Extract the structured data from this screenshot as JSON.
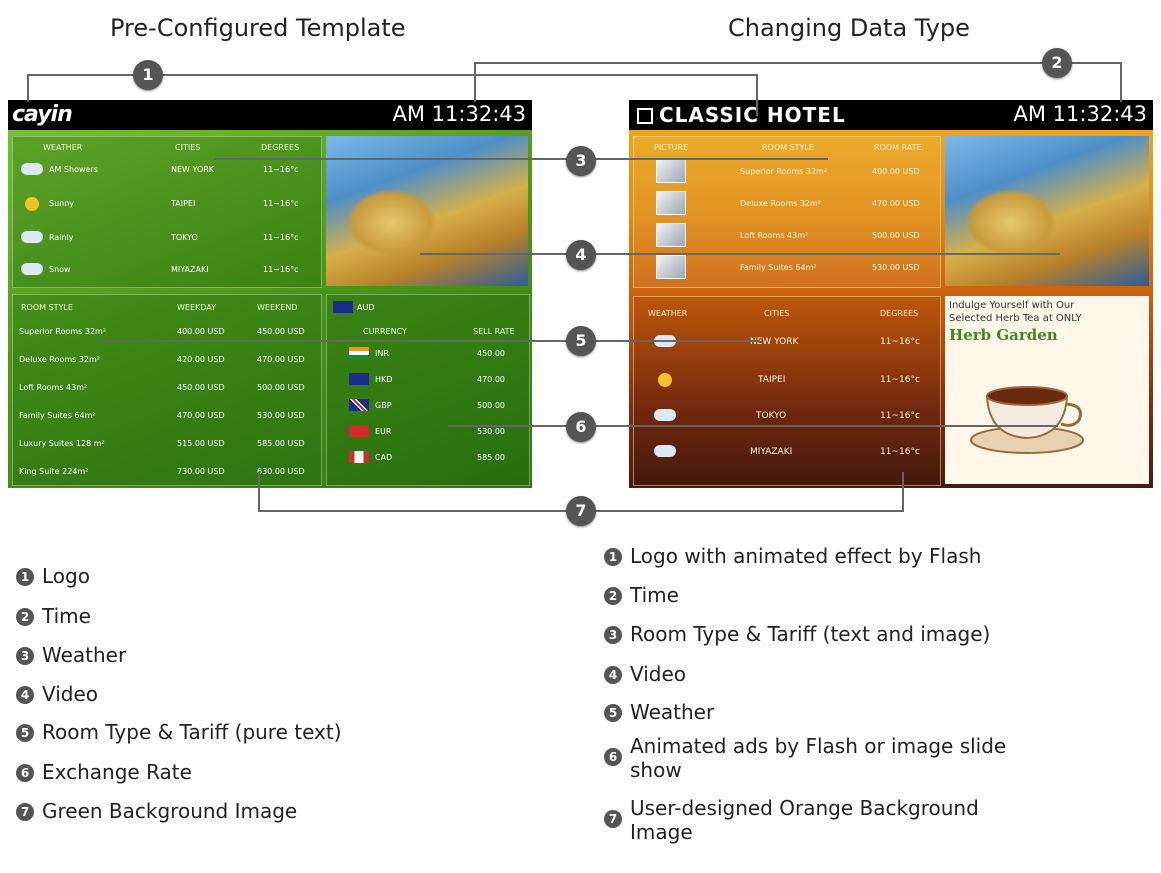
{
  "headings": {
    "left": "Pre-Configured Template",
    "right": "Changing Data Type"
  },
  "left_panel": {
    "time": "AM 11:32:43",
    "logo_text": "cayin",
    "weather": {
      "headers": [
        "WEATHER",
        "CITIES",
        "DEGREES"
      ],
      "rows": [
        {
          "weather": "AM Showers",
          "city": "NEW YORK",
          "degrees": "11~16°c"
        },
        {
          "weather": "Sunny",
          "city": "TAIPEI",
          "degrees": "11~16°c"
        },
        {
          "weather": "Rainly",
          "city": "TOKYO",
          "degrees": "11~16°c"
        },
        {
          "weather": "Snow",
          "city": "MIYAZAKI",
          "degrees": "11~16°c"
        }
      ]
    },
    "rooms": {
      "headers": [
        "ROOM STYLE",
        "WEEKDAY",
        "WEEKEND"
      ],
      "rows": [
        {
          "style": "Superior Rooms 32m²",
          "weekday": "400.00 USD",
          "weekend": "450.00 USD"
        },
        {
          "style": "Deluxe Rooms 32m²",
          "weekday": "420.00 USD",
          "weekend": "470.00 USD"
        },
        {
          "style": "Loft Rooms 43m²",
          "weekday": "450.00 USD",
          "weekend": "500.00 USD"
        },
        {
          "style": "Family Suites 64m²",
          "weekday": "470.00 USD",
          "weekend": "530.00 USD"
        },
        {
          "style": "Luxury Suites 128 m²",
          "weekday": "515.00 USD",
          "weekend": "585.00 USD"
        },
        {
          "style": "King Suite 224m²",
          "weekday": "730.00 USD",
          "weekend": "630.00 USD"
        }
      ]
    },
    "exchange": {
      "base": "AUD",
      "headers": [
        "CURRENCY",
        "SELL RATE"
      ],
      "rows": [
        {
          "currency": "INR",
          "rate": "450.00"
        },
        {
          "currency": "HKD",
          "rate": "470.00"
        },
        {
          "currency": "GBP",
          "rate": "500.00"
        },
        {
          "currency": "EUR",
          "rate": "530.00"
        },
        {
          "currency": "CAD",
          "rate": "585.00"
        }
      ]
    }
  },
  "right_panel": {
    "time": "AM 11:32:43",
    "logo_text": "CLASSIC HOTEL",
    "rooms": {
      "headers": [
        "PICTURE",
        "ROOM STYLE",
        "ROOM RATE"
      ],
      "rows": [
        {
          "style": "Superior Rooms 32m²",
          "rate": "400.00 USD"
        },
        {
          "style": "Deluxe Rooms 32m²",
          "rate": "470.00 USD"
        },
        {
          "style": "Loft Rooms 43m²",
          "rate": "500.00 USD"
        },
        {
          "style": "Family Suites 64m²",
          "rate": "530.00 USD"
        }
      ]
    },
    "weather": {
      "headers": [
        "WEATHER",
        "CITIES",
        "DEGREES"
      ],
      "rows": [
        {
          "city": "NEW YORK",
          "degrees": "11~16°c"
        },
        {
          "city": "TAIPEI",
          "degrees": "11~16°c"
        },
        {
          "city": "TOKYO",
          "degrees": "11~16°c"
        },
        {
          "city": "MIYAZAKI",
          "degrees": "11~16°c"
        }
      ]
    },
    "ad": {
      "line1": "Indulge Yourself with Our",
      "line2": "Selected Herb Tea at ONLY",
      "title": "Herb Garden"
    }
  },
  "callouts": [
    "1",
    "2",
    "3",
    "4",
    "5",
    "6",
    "7"
  ],
  "legend_left": [
    {
      "num": "1",
      "text": "Logo"
    },
    {
      "num": "2",
      "text": "Time"
    },
    {
      "num": "3",
      "text": "Weather"
    },
    {
      "num": "4",
      "text": "Video"
    },
    {
      "num": "5",
      "text": "Room Type & Tariff (pure text)"
    },
    {
      "num": "6",
      "text": "Exchange Rate"
    },
    {
      "num": "7",
      "text": "Green Background Image"
    }
  ],
  "legend_right": [
    {
      "num": "1",
      "text": "Logo with animated effect by Flash"
    },
    {
      "num": "2",
      "text": "Time"
    },
    {
      "num": "3",
      "text": "Room Type & Tariff (text and image)"
    },
    {
      "num": "4",
      "text": "Video"
    },
    {
      "num": "5",
      "text": "Weather"
    },
    {
      "num": "6",
      "line1": "Animated ads by Flash or image slide",
      "line2": "show"
    },
    {
      "num": "7",
      "line1": "User-designed Orange Background",
      "line2": "Image"
    }
  ]
}
